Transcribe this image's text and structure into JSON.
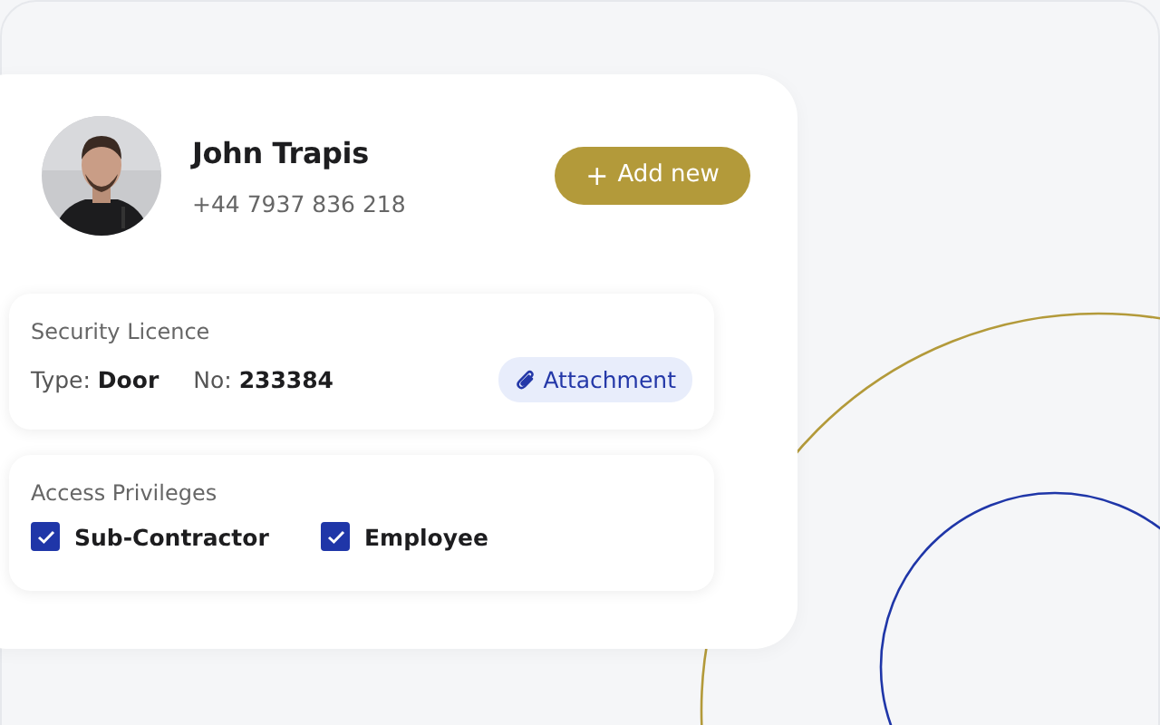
{
  "profile": {
    "name": "John Trapis",
    "phone": "+44 7937 836 218",
    "add_button": {
      "icon": "+",
      "label": "Add new"
    }
  },
  "licence": {
    "title": "Security Licence",
    "type_label": "Type:",
    "type_value": "Door",
    "no_label": "No:",
    "no_value": "233384",
    "attachment": "Attachment"
  },
  "access": {
    "title": "Access Privileges",
    "options": [
      {
        "label": "Sub-Contractor",
        "checked": true
      },
      {
        "label": "Employee",
        "checked": true
      }
    ]
  }
}
